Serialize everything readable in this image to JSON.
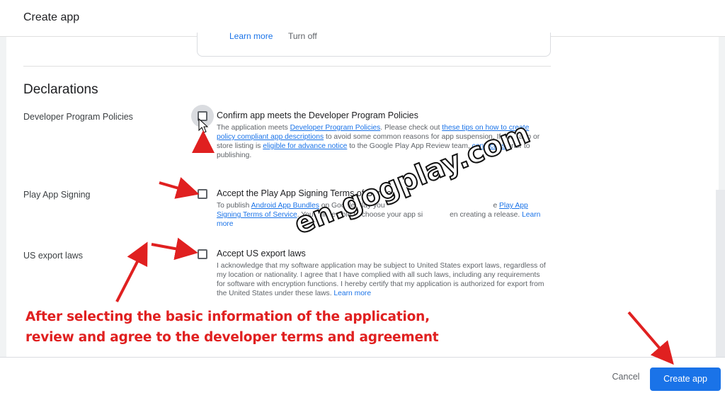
{
  "dialog": {
    "title": "Create app"
  },
  "previous_card": {
    "link_1": "Learn more",
    "link_2": "Turn off"
  },
  "declarations": {
    "title": "Declarations",
    "rows": [
      {
        "label": "Developer Program Policies",
        "option_title": "Confirm app meets the Developer Program Policies",
        "checked": false,
        "focused": true,
        "desc": {
          "t1": "The application meets ",
          "link1": "Developer Program Policies",
          "t2": ". Please check out ",
          "link2": "these tips on how to create policy compliant app descriptions",
          "t3": " to avoid some common reasons for app suspension. If your app or store listing is ",
          "link3": "eligible for advance notice",
          "t4": " to the Google Play App Review team, ",
          "link4": "contact us",
          "t5": " prior to publishing."
        }
      },
      {
        "label": "Play App Signing",
        "option_title": "Accept the Play App Signing Terms of Service",
        "checked": false,
        "desc": {
          "t1": "To publish ",
          "link1": "Android App Bundles",
          "t2": " on Google Play you ",
          "t3": "e ",
          "link2": "Play App Signing Terms of Service",
          "t4": ". You will be able to choose your app si",
          "t5": "en creating a release. ",
          "link3": "Learn more"
        }
      },
      {
        "label": "US export laws",
        "option_title": "Accept US export laws",
        "checked": false,
        "desc": {
          "text": "I acknowledge that my software application may be subject to United States export laws, regardless of my location or nationality. I agree that I have complied with all such laws, including any requirements for software with encryption functions. I hereby certify that my application is authorized for export from the United States under these laws. ",
          "link": "Learn more"
        }
      }
    ]
  },
  "footer": {
    "cancel_label": "Cancel",
    "create_label": "Create app"
  },
  "annotation": {
    "watermark": "en.gogplay.com",
    "caption_line1": "After selecting the basic information of the application,",
    "caption_line2": "review and agree to the developer terms and agreement",
    "color": "#e02020"
  },
  "colors": {
    "primary": "#1a73e8",
    "link": "#1a73e8",
    "text": "#202124",
    "muted": "#5f6368"
  }
}
